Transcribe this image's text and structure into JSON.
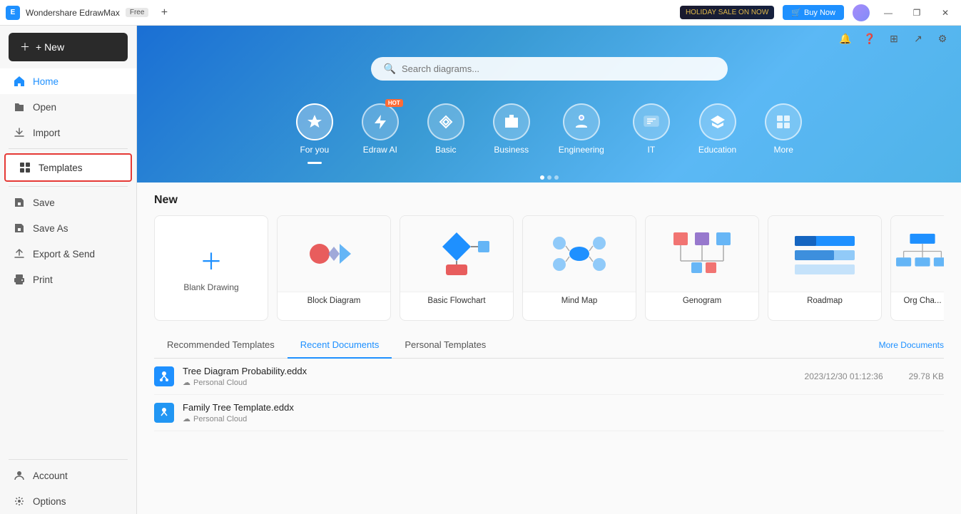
{
  "titlebar": {
    "app_name": "Wondershare EdrawMax",
    "free_label": "Free",
    "new_tab_icon": "+",
    "holiday_label": "HOLIDAY SALE ON NOW",
    "buy_label": "Buy Now",
    "minimize": "—",
    "maximize": "❐",
    "close": "✕"
  },
  "sidebar": {
    "new_label": "+ New",
    "items": [
      {
        "id": "home",
        "label": "Home",
        "icon": "🏠",
        "active": true
      },
      {
        "id": "open",
        "label": "Open",
        "icon": "📄"
      },
      {
        "id": "import",
        "label": "Import",
        "icon": "📥"
      },
      {
        "id": "templates",
        "label": "Templates",
        "icon": "⊞",
        "selected": true
      },
      {
        "id": "save",
        "label": "Save",
        "icon": "💾"
      },
      {
        "id": "saveas",
        "label": "Save As",
        "icon": "📋"
      },
      {
        "id": "export",
        "label": "Export & Send",
        "icon": "📤"
      },
      {
        "id": "print",
        "label": "Print",
        "icon": "🖨️"
      }
    ],
    "bottom_items": [
      {
        "id": "account",
        "label": "Account",
        "icon": "👤"
      },
      {
        "id": "options",
        "label": "Options",
        "icon": "⚙️"
      }
    ]
  },
  "banner": {
    "search_placeholder": "Search diagrams...",
    "categories": [
      {
        "id": "foryou",
        "label": "For you",
        "icon": "✦",
        "active": true
      },
      {
        "id": "edrawai",
        "label": "Edraw AI",
        "icon": "⚡",
        "hot": true
      },
      {
        "id": "basic",
        "label": "Basic",
        "icon": "✦"
      },
      {
        "id": "business",
        "label": "Business",
        "icon": "💼"
      },
      {
        "id": "engineering",
        "label": "Engineering",
        "icon": "⚙"
      },
      {
        "id": "it",
        "label": "IT",
        "icon": "🖥"
      },
      {
        "id": "education",
        "label": "Education",
        "icon": "🎓"
      },
      {
        "id": "more",
        "label": "More",
        "icon": "⊞"
      }
    ]
  },
  "new_section": {
    "title": "New",
    "blank_label": "Blank Drawing",
    "templates": [
      {
        "id": "block",
        "label": "Block Diagram"
      },
      {
        "id": "flowchart",
        "label": "Basic Flowchart"
      },
      {
        "id": "mindmap",
        "label": "Mind Map"
      },
      {
        "id": "genogram",
        "label": "Genogram"
      },
      {
        "id": "roadmap",
        "label": "Roadmap"
      },
      {
        "id": "orgchart",
        "label": "Org Cha..."
      }
    ]
  },
  "tabs_section": {
    "tabs": [
      {
        "id": "recommended",
        "label": "Recommended Templates"
      },
      {
        "id": "recent",
        "label": "Recent Documents",
        "active": true
      },
      {
        "id": "personal",
        "label": "Personal Templates"
      }
    ],
    "more_docs_label": "More Documents"
  },
  "recent_docs": [
    {
      "name": "Tree Diagram Probability.eddx",
      "location": "Personal Cloud",
      "date": "2023/12/30 01:12:36",
      "size": "29.78 KB"
    },
    {
      "name": "Family Tree Template.eddx",
      "location": "Personal Cloud",
      "date": "",
      "size": ""
    }
  ]
}
